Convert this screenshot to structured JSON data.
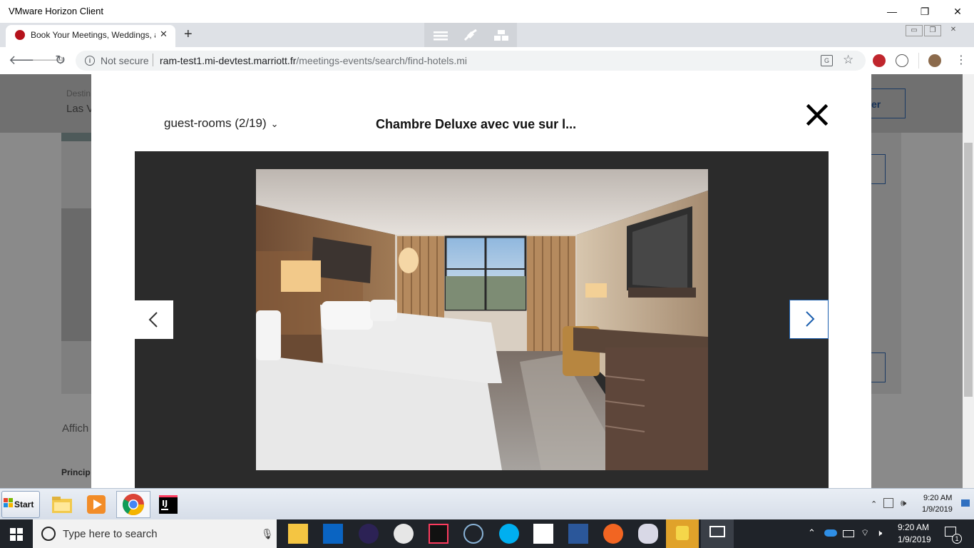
{
  "vmware": {
    "window_title": "VMware Horizon Client",
    "minimize": "—",
    "restore": "❐",
    "close": "✕"
  },
  "browser": {
    "tab_title": "Book Your Meetings, Weddings, and",
    "tab_close": "✕",
    "new_tab": "+",
    "not_secure": "Not secure",
    "url_host": "ram-test1.mi-devtest.marriott.fr",
    "url_path": "/meetings-events/search/find-hotels.mi"
  },
  "page": {
    "dest_label": "Destin",
    "dest_value": "Las V",
    "button_fragment": "er",
    "affich": "Affich",
    "princip": "Princip"
  },
  "modal": {
    "gallery_label": "guest-rooms (2/19)",
    "photo_title": "Chambre Deluxe avec vue sur l...",
    "close_label": "✕"
  },
  "vm_taskbar": {
    "start_label": "Start",
    "time": "9:20 AM",
    "date": "1/9/2019"
  },
  "host_taskbar": {
    "search_placeholder": "Type here to search",
    "time": "9:20 AM",
    "date": "1/9/2019",
    "notif_count": "1"
  }
}
